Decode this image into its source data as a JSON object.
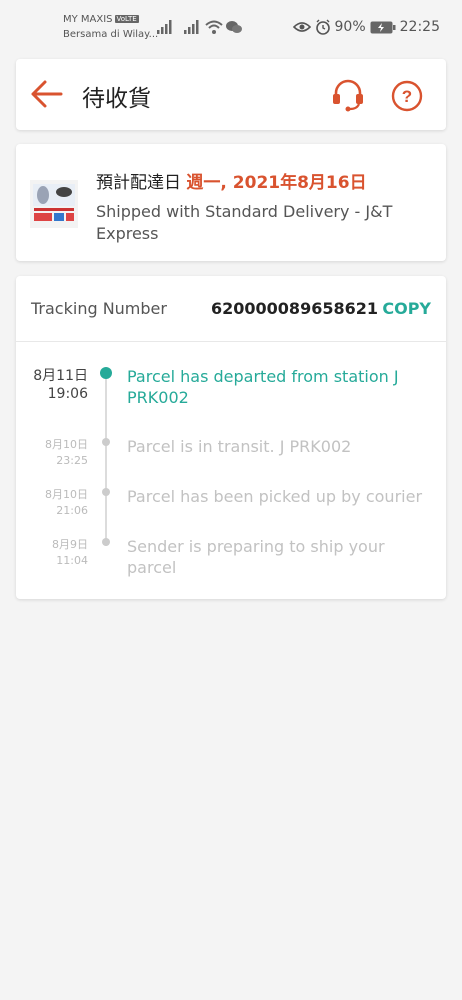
{
  "status_bar": {
    "carrier": "MY MAXIS",
    "volte": "VoLTE",
    "carrier_sub": "Bersama di Wilay...",
    "battery": "90%",
    "time": "22:25"
  },
  "header": {
    "title": "待收貨"
  },
  "delivery": {
    "eta_label": "預計配達日",
    "eta_date": "週一, 2021年8月16日",
    "shipped_text": "Shipped with Standard Delivery  - J&T Express"
  },
  "tracking": {
    "label": "Tracking Number",
    "number": "620000089658621",
    "copy_label": "COPY",
    "events": [
      {
        "date": "8月11日",
        "time": "19:06",
        "text": "Parcel has departed from station J PRK002"
      },
      {
        "date": "8月10日",
        "time": "23:25",
        "text": "Parcel is in transit. J PRK002"
      },
      {
        "date": "8月10日",
        "time": "21:06",
        "text": "Parcel has been picked up by courier"
      },
      {
        "date": "8月9日",
        "time": "11:04",
        "text": "Sender is preparing to ship your parcel"
      }
    ]
  },
  "colors": {
    "accent": "#d9532f",
    "teal": "#26aa99"
  }
}
